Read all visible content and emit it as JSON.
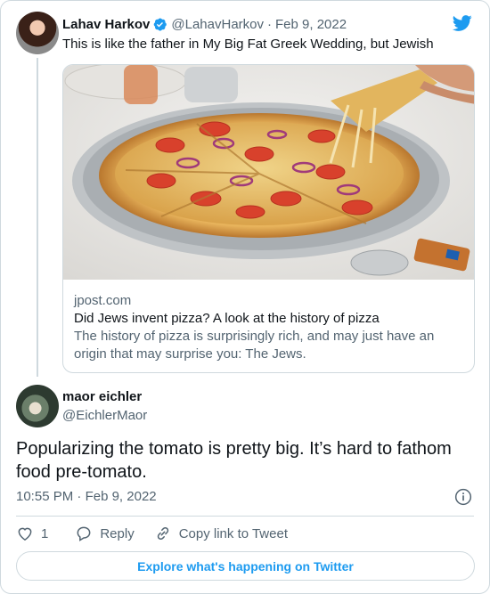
{
  "colors": {
    "accent": "#1d9bf0",
    "muted": "#536471",
    "border": "#cfd9de",
    "text": "#0f1419"
  },
  "quoted": {
    "author_name": "Lahav Harkov",
    "author_handle": "@LahavHarkov",
    "separator": "·",
    "date": "Feb 9, 2022",
    "verified_icon": "verified-badge-icon",
    "text": "This is like the father in My Big Fat Greek Wedding, but Jewish",
    "link": {
      "domain": "jpost.com",
      "title": "Did Jews invent pizza? A look at the history of pizza",
      "description": "The history of pizza is surprisingly rich, and may just have an origin that may surprise you: The Jews."
    }
  },
  "tweet": {
    "author_name": "maor eichler",
    "author_handle": "@EichlerMaor",
    "text": "Popularizing the tomato is pretty big. It’s hard to fathom food pre-tomato.",
    "time": "10:55 PM",
    "separator": "·",
    "date": "Feb 9, 2022"
  },
  "actions": {
    "like_count": "1",
    "reply_label": "Reply",
    "copy_link_label": "Copy link to Tweet"
  },
  "explore_label": "Explore what's happening on Twitter"
}
